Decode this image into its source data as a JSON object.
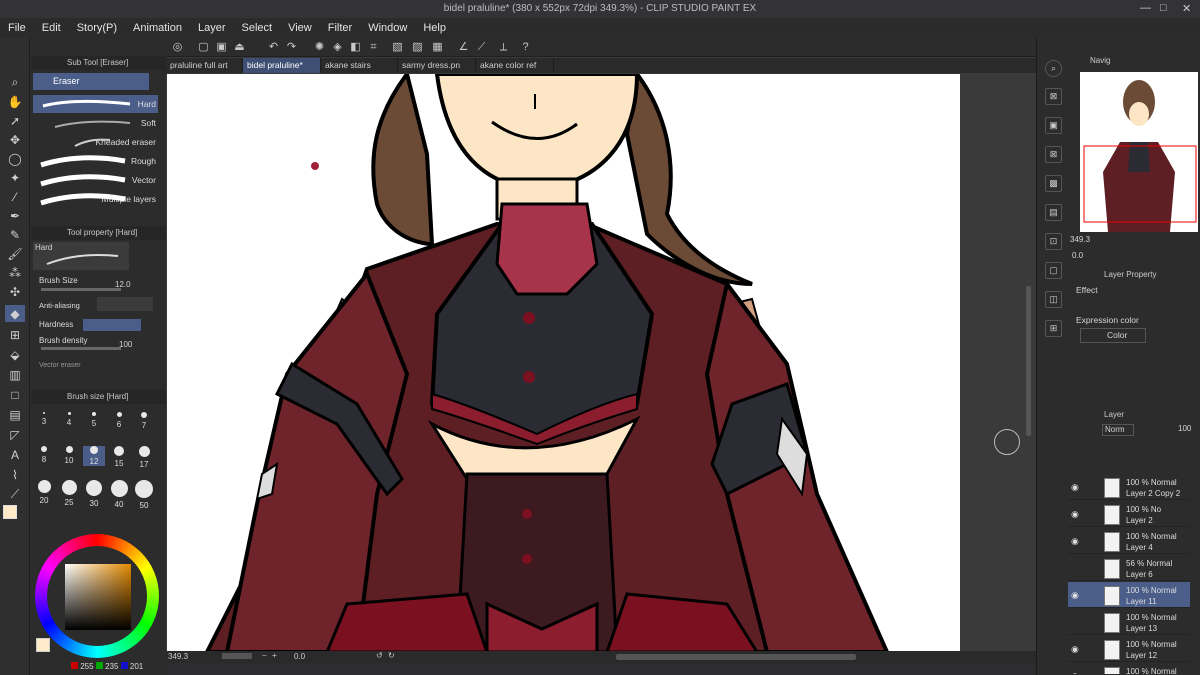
{
  "app": {
    "title": "bidel praluline* (380 x 552px 72dpi 349.3%)  - CLIP STUDIO PAINT EX"
  },
  "menu": [
    "File",
    "Edit",
    "Story(P)",
    "Animation",
    "Layer",
    "Select",
    "View",
    "Filter",
    "Window",
    "Help"
  ],
  "subtool": {
    "header": "Sub Tool [Eraser]",
    "group": "Eraser",
    "brushes": [
      "Hard",
      "Soft",
      "Kneaded eraser",
      "Rough",
      "Vector",
      "Multiple layers"
    ],
    "selected": "Hard"
  },
  "toolprop": {
    "header": "Tool property [Hard]",
    "preset": "Hard",
    "brush_size_label": "Brush Size",
    "brush_size": "12.0",
    "antialias_label": "Anti-aliasing",
    "hardness_label": "Hardness",
    "density_label": "Brush density",
    "density": "100",
    "vector_label": "Vector eraser"
  },
  "brushsize": {
    "header": "Brush size [Hard]",
    "sizes": [
      "3",
      "4",
      "5",
      "6",
      "7",
      "8",
      "10",
      "12",
      "15",
      "17",
      "20",
      "25",
      "30",
      "40",
      "50"
    ],
    "selected": "12"
  },
  "color": {
    "r": "255",
    "g": "235",
    "b": "201",
    "main": "#ffebc9"
  },
  "tabs": [
    {
      "label": "praluline full art",
      "active": false
    },
    {
      "label": "bidel praluline*",
      "active": true
    },
    {
      "label": "akane stairs",
      "active": false
    },
    {
      "label": "sarmy dress.pn",
      "active": false
    },
    {
      "label": "akane color ref",
      "active": false
    }
  ],
  "status": {
    "zoom": "349.3",
    "angle": "0.0"
  },
  "navigator": {
    "tab": "Navig",
    "zoom": "349.3",
    "angle": "0.0"
  },
  "layerprop": {
    "tab": "Layer Property",
    "effect_label": "Effect",
    "expr_label": "Expression color",
    "expr_value": "Color"
  },
  "layers": {
    "tab": "Layer",
    "blend": "Norm",
    "opacity": "100",
    "items": [
      {
        "mode": "100 % Normal",
        "name": "Layer 2 Copy 2",
        "visible": true,
        "selected": false
      },
      {
        "mode": "100 % No",
        "name": "Layer 2",
        "visible": true,
        "selected": false
      },
      {
        "mode": "100 % Normal",
        "name": "Layer 4",
        "visible": true,
        "selected": false
      },
      {
        "mode": "56 % Normal",
        "name": "Layer 6",
        "visible": false,
        "selected": false
      },
      {
        "mode": "100 % Normal",
        "name": "Layer 11",
        "visible": true,
        "selected": true
      },
      {
        "mode": "100 % Normal",
        "name": "Layer 13",
        "visible": false,
        "selected": false
      },
      {
        "mode": "100 % Normal",
        "name": "Layer 12",
        "visible": true,
        "selected": false
      },
      {
        "mode": "100 % Normal",
        "name": "",
        "visible": true,
        "selected": false
      }
    ]
  },
  "colors": {
    "accent": "#4b5e8a",
    "dress": "#5e1f24",
    "hair": "#6b4a36",
    "skin": "#fde6c6"
  }
}
